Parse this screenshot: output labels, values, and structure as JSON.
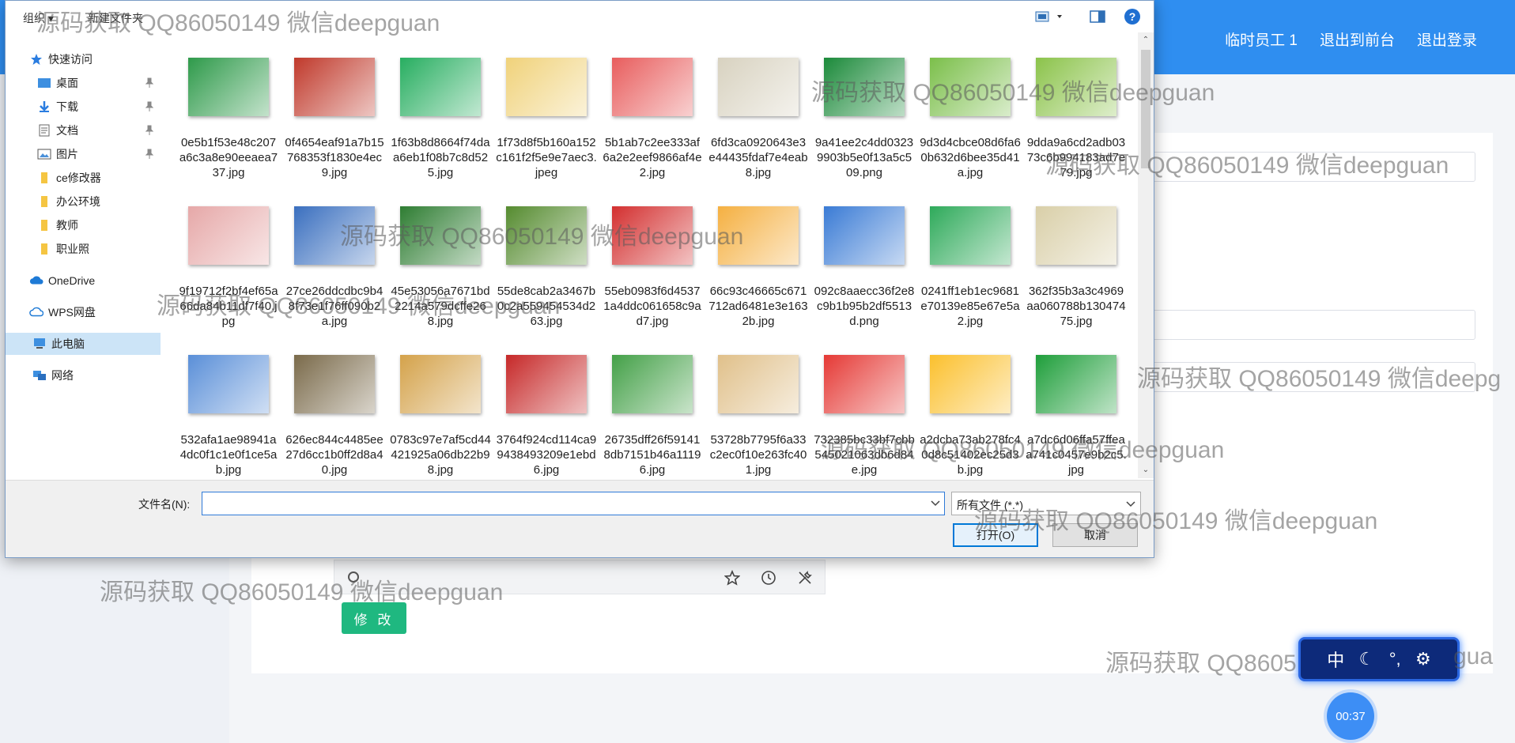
{
  "app": {
    "header": {
      "user": "临时员工 1",
      "back_to_front": "退出到前台",
      "logout": "退出登录"
    },
    "modify_button": "修 改",
    "ime": {
      "lang": "中"
    },
    "timer": "00:37"
  },
  "dialog": {
    "toolbar": {
      "organize": "组织 ▾",
      "new_folder": "新建文件夹"
    },
    "nav": {
      "quick_access": "快速访问",
      "desktop": "桌面",
      "downloads": "下载",
      "documents": "文档",
      "pictures": "图片",
      "ce": "ce修改器",
      "office": "办公环境",
      "teacher": "教师",
      "license": "职业照",
      "onedrive": "OneDrive",
      "wps": "WPS网盘",
      "this_pc": "此电脑",
      "network": "网络"
    },
    "files": [
      {
        "name": "0e5b1f53e48c207a6c3a8e90eeaea737.jpg",
        "color": "#2e9a4a"
      },
      {
        "name": "0f4654eaf91a7b15768353f1830e4ec9.jpg",
        "color": "#c0392b"
      },
      {
        "name": "1f63b8d8664f74daa6eb1f08b7c8d525.jpg",
        "color": "#27ae60"
      },
      {
        "name": "1f73d8f5b160a152c161f2f5e9e7aec3.jpeg",
        "color": "#f0d27a"
      },
      {
        "name": "5b1ab7c2ee333af6a2e2eef9866af4e2.jpg",
        "color": "#e85d5d"
      },
      {
        "name": "6fd3ca0920643e3e44435fdaf7e4eab8.jpg",
        "color": "#d8d2c0"
      },
      {
        "name": "9a41ee2c4dd03239903b5e0f13a5c509.png",
        "color": "#1b8a3a"
      },
      {
        "name": "9d3d4cbce08d6fa60b632d6bee35d41a.jpg",
        "color": "#7bbf4a"
      },
      {
        "name": "9dda9a6cd2adb0373c6b994183ad7e79.jpg",
        "color": "#8bc34a"
      },
      {
        "name": "9f19712f2bf4ef65a66da84b11df7f40.jpg",
        "color": "#e6a8a8"
      },
      {
        "name": "27ce26ddcdbc9b48f73e1f76ff090b2a.jpg",
        "color": "#3a6fbf"
      },
      {
        "name": "45e53056a7671bd2214a579dcffe268.jpg",
        "color": "#2e7d32"
      },
      {
        "name": "55de8cab2a3467b0c2a559454534d263.jpg",
        "color": "#558b2f"
      },
      {
        "name": "55eb0983f6d45371a4ddc061658c9ad7.jpg",
        "color": "#d32f2f"
      },
      {
        "name": "66c93c46665c671712ad6481e3e1632b.jpg",
        "color": "#f5b041"
      },
      {
        "name": "092c8aaecc36f2e8c9b1b95b2df5513d.png",
        "color": "#3a7bd5"
      },
      {
        "name": "0241ff1eb1ec9681e70139e85e67e5a2.jpg",
        "color": "#2eaa5a"
      },
      {
        "name": "362f35b3a3c4969aa060788b13047475.jpg",
        "color": "#d9cfa8"
      },
      {
        "name": "532afa1ae98941a4dc0f1c1e0f1ce5ab.jpg",
        "color": "#5a8fd8"
      },
      {
        "name": "626ec844c4485ee27d6cc1b0ff2d8a40.jpg",
        "color": "#7a6a4a"
      },
      {
        "name": "0783c97e7af5cd44421925a06db22b98.jpg",
        "color": "#d4a24a"
      },
      {
        "name": "3764f924cd114ca99438493209e1ebd6.jpg",
        "color": "#c62828"
      },
      {
        "name": "26735dff26f591418db7151b46a11196.jpg",
        "color": "#43a047"
      },
      {
        "name": "53728b7795f6a33c2ec0f10e263fc401.jpg",
        "color": "#e0c08a"
      },
      {
        "name": "732385bc33bf7cbb54502106​3db6d84e.jpg",
        "color": "#e53935"
      },
      {
        "name": "a2dcba73ab278fc40d8c51402ec25d3b.jpg",
        "color": "#fbc02d"
      },
      {
        "name": "a7dc6d06ffa57ffeaa741c0457e9b2c5.jpg",
        "color": "#1e9e3a"
      }
    ],
    "filename_label": "文件名(N):",
    "filename_value": "",
    "filter": "所有文件 (*.*)",
    "open": "打开(O)",
    "cancel": "取消"
  },
  "watermark": "源码获取 QQ86050149 微信deepguan",
  "watermark_cut": "源码获取 QQ86050149 微信deepg",
  "watermark_cut2": "源码获取 QQ8605",
  "watermark_tail": "gua"
}
